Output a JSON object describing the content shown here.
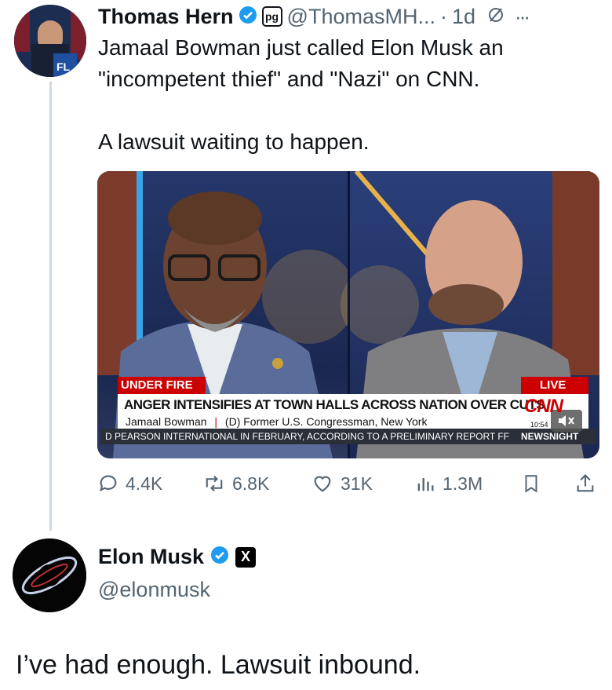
{
  "tweet": {
    "author_name": "Thomas Hern",
    "author_handle": "@ThomasMH...",
    "separator": "·",
    "time": "1d",
    "badge_text": "pg",
    "more": "···",
    "text_line1": "Jamaal Bowman just called Elon Musk an",
    "text_line2": "\"incompetent thief\" and \"Nazi\" on CNN.",
    "text_line3": "A lawsuit waiting to happen."
  },
  "media": {
    "banner_tag": "UNDER FIRE",
    "live_label": "LIVE",
    "headline": "ANGER INTENSIFIES AT TOWN HALLS ACROSS NATION OVER CUTS",
    "subtitle_name": "Jamaal Bowman",
    "subtitle_sep": "|",
    "subtitle_role": "(D) Former U.S. Congressman, New York",
    "network": "CNN",
    "clock": "10:54",
    "ticker": "D PEARSON INTERNATIONAL IN FEBRUARY, ACCORDING TO A PRELIMINARY REPORT FF",
    "ticker_brand": "NEWSNIGHT",
    "mute_icon": "speaker-muted"
  },
  "actions": {
    "replies": "4.4K",
    "reposts": "6.8K",
    "likes": "31K",
    "views": "1.3M"
  },
  "reply": {
    "author_name": "Elon Musk",
    "author_handle": "@elonmusk",
    "affiliate_badge": "X",
    "text": "I’ve had enough. Lawsuit inbound."
  },
  "colors": {
    "verified": "#1d9bf0",
    "secondary_text": "#536471",
    "thread_line": "#cfd9de",
    "cnn_red": "#cc0000"
  }
}
